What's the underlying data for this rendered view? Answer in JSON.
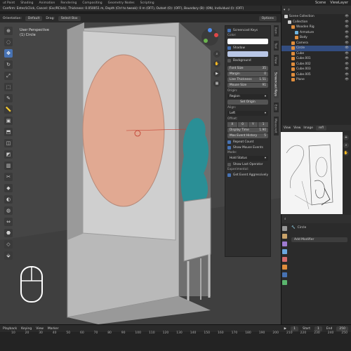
{
  "topbar": {
    "tabs": [
      "ut Paint",
      "Shading",
      "Animation",
      "Rendering",
      "Compositing",
      "Geometry Nodes",
      "Scripting"
    ],
    "scene_label": "Scene",
    "viewlayer_label": "ViewLayer"
  },
  "status": {
    "text": "Confirm: Enter/LClick, Cancel: (Esc/RClick), Thickness: 0.050051 m, Depth (Ctrl to tweak): 0 m (OFF), Outset (O): (OFF), Boundary (B): (ON), Individual (I): (OFF)"
  },
  "viewport_header": {
    "orientation_label": "Orientation:",
    "orientation_value": "Default",
    "drag_label": "Drag:",
    "select_value": "Select Box",
    "options_label": "Options"
  },
  "viewport": {
    "view_name": "User Perspective",
    "object_name": "(1) Circle"
  },
  "toolbar": {
    "icons": [
      "cursor-icon",
      "select-icon",
      "move-icon",
      "rotate-icon",
      "scale-icon",
      "transform-icon",
      "annotate-icon",
      "measure-icon",
      "add-cube-icon",
      "extrude-icon",
      "inset-icon",
      "bevel-icon",
      "loopcut-icon",
      "knife-icon",
      "polybuild-icon",
      "spin-icon",
      "smooth-icon",
      "edge-slide-icon",
      "shrink-icon",
      "shear-icon",
      "rip-icon"
    ]
  },
  "panel": {
    "title": "Screencast Keys",
    "color_label": "Color:",
    "shadow_label": "Shadow",
    "background_label": "Background",
    "font_size_label": "Font Size",
    "font_size_value": "35",
    "margin_label": "Margin",
    "margin_value": "0",
    "line_thickness_label": "Line Thickness",
    "line_thickness_value": "1.51",
    "mouse_size_label": "Mouse Size",
    "mouse_size_value": "91",
    "origin_label": "Origin:",
    "origin_value": "Region",
    "set_origin_label": "Set Origin",
    "align_label": "Align:",
    "align_value": "Left",
    "offset_label": "Offset:",
    "offset_x": "X",
    "offset_x_value": "0",
    "offset_y": "Y",
    "offset_y_value": "1",
    "display_time_label": "Display Time",
    "display_time_value": "1.90",
    "max_event_label": "Max Event History",
    "max_event_value": "5",
    "repeat_count_label": "Repeat Count",
    "show_mouse_label": "Show Mouse Events",
    "mode_label": "Mode:",
    "mode_value": "Hold Status",
    "show_last_label": "Show Last Operator",
    "experimental_label": "Experimental:",
    "get_event_label": "Get Event Aggressively",
    "colors": {
      "color_swatch": "#ffffff",
      "shadow_swatch": "#b9c7e6"
    }
  },
  "side_tabs": [
    "Item",
    "Tool",
    "View",
    "Screencast Keys",
    "Edit",
    "Measureit"
  ],
  "outliner": {
    "header": "Scene Collection",
    "items": [
      {
        "label": "Scene Collection",
        "indent": 0,
        "icon": "#cfcfcf"
      },
      {
        "label": "Collection",
        "indent": 1,
        "icon": "#cfcfcf"
      },
      {
        "label": "Wooden Rig",
        "indent": 2,
        "icon": "#e08d3c"
      },
      {
        "label": "Armature",
        "indent": 3,
        "icon": "#6fb5e0"
      },
      {
        "label": "Body",
        "indent": 3,
        "icon": "#e08d3c"
      },
      {
        "label": "Camera",
        "indent": 2,
        "icon": "#e08d3c"
      },
      {
        "label": "Circle",
        "indent": 2,
        "icon": "#e08d3c"
      },
      {
        "label": "Cube",
        "indent": 2,
        "icon": "#e08d3c"
      },
      {
        "label": "Cube.001",
        "indent": 2,
        "icon": "#e08d3c"
      },
      {
        "label": "Cube.002",
        "indent": 2,
        "icon": "#e08d3c"
      },
      {
        "label": "Cube.003",
        "indent": 2,
        "icon": "#e08d3c"
      },
      {
        "label": "Cube.005",
        "indent": 2,
        "icon": "#e08d3c"
      },
      {
        "label": "Plane",
        "indent": 2,
        "icon": "#e08d3c"
      }
    ]
  },
  "image_editor": {
    "view_label": "View",
    "view2_label": "View",
    "image_label": "Image",
    "image_name": "refl"
  },
  "properties": {
    "object_name": "Circle",
    "add_modifier_label": "Add Modifier"
  },
  "timeline": {
    "playback_label": "Playback",
    "keying_label": "Keying",
    "view_label": "View",
    "marker_label": "Marker",
    "start_label": "Start",
    "start_value": "1",
    "end_label": "End",
    "end_value": "250",
    "current_frame": "1",
    "ruler": [
      "10",
      "20",
      "30",
      "40",
      "50",
      "60",
      "70",
      "80",
      "90",
      "100",
      "110",
      "120",
      "130",
      "140",
      "150",
      "160",
      "170",
      "180",
      "190",
      "200",
      "210",
      "220",
      "230",
      "240",
      "250"
    ]
  }
}
